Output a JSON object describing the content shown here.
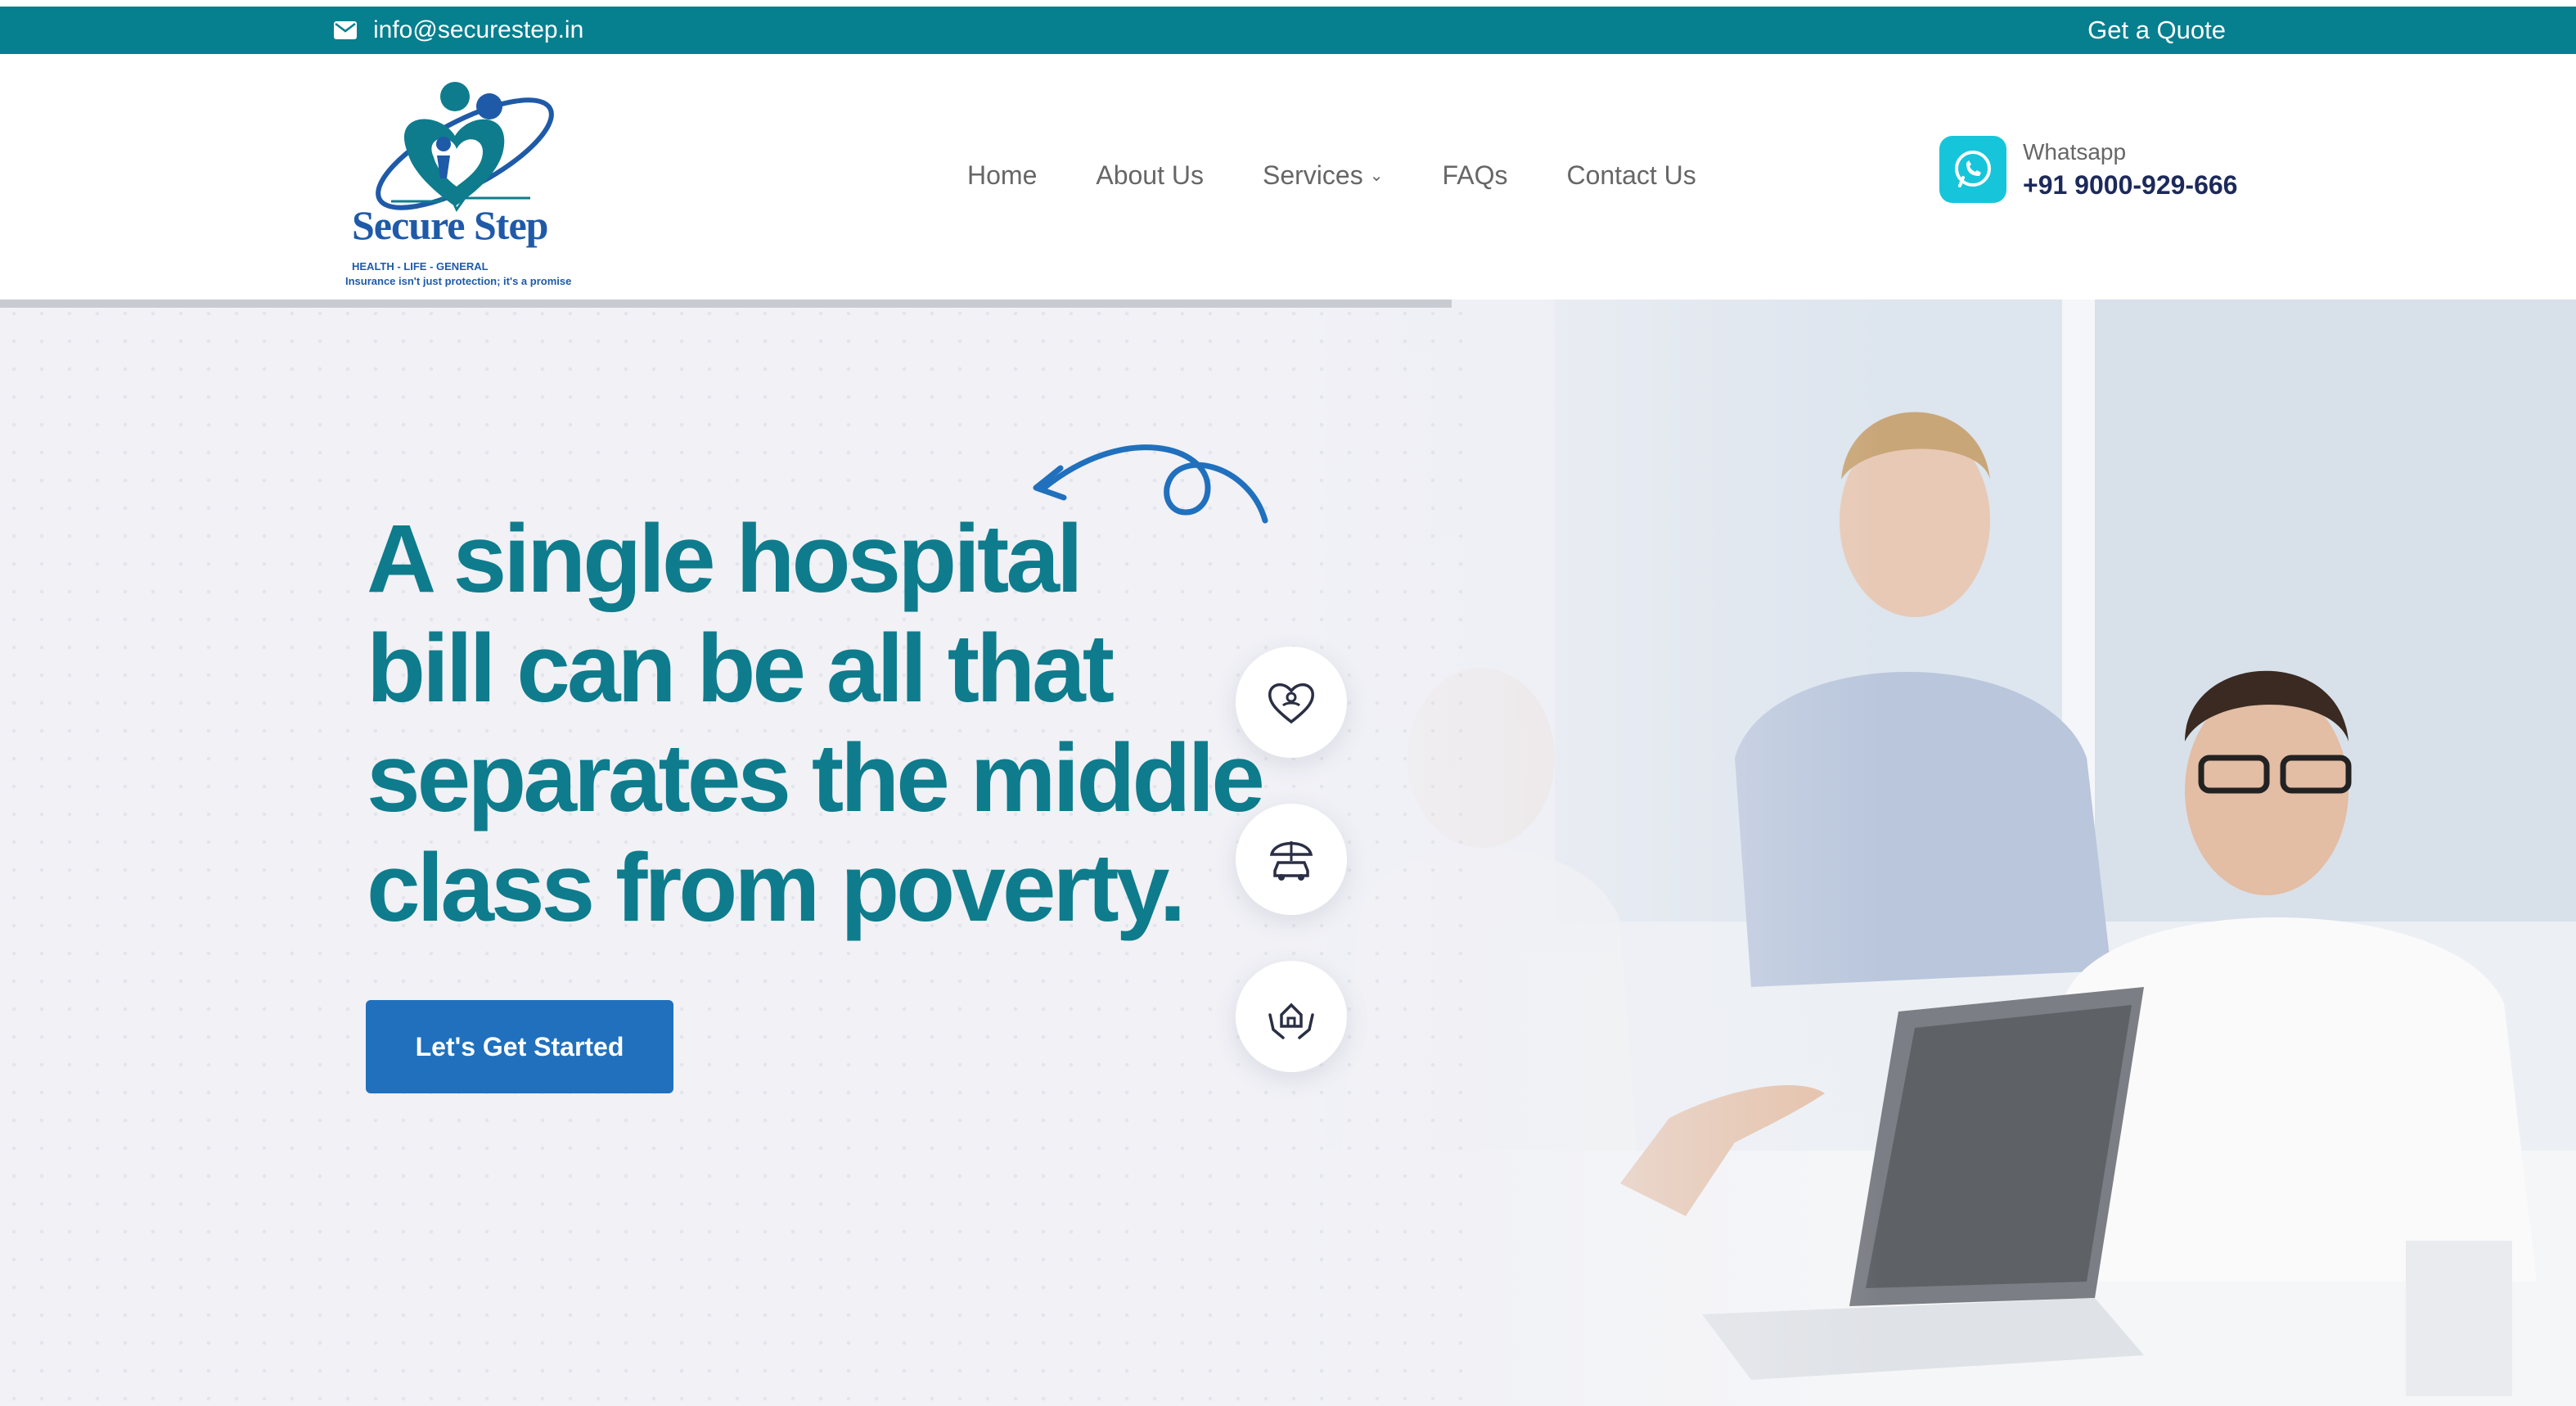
{
  "topbar": {
    "email": "info@securestep.in",
    "quote_label": "Get a Quote",
    "background": "#067f8f"
  },
  "header": {
    "logo": {
      "name": "Secure Step",
      "sub": "HEALTH - LIFE - GENERAL",
      "tagline": "Insurance isn't just protection; it's a promise"
    },
    "nav": [
      {
        "label": "Home"
      },
      {
        "label": "About Us"
      },
      {
        "label": "Services",
        "has_dropdown": true
      },
      {
        "label": "FAQs"
      },
      {
        "label": "Contact Us"
      }
    ],
    "whatsapp": {
      "label": "Whatsapp",
      "number": "+91 9000-929-666",
      "icon": "whatsapp-icon"
    }
  },
  "hero": {
    "headline_lines": [
      "A single hospital",
      "bill can be all that",
      "separates the middle",
      "class from poverty."
    ],
    "cta_label": "Let's Get Started",
    "side_icons": [
      "heart-care-icon",
      "car-umbrella-icon",
      "house-hands-icon"
    ],
    "colors": {
      "headline": "#0e7c8c",
      "cta": "#2070bd",
      "accent": "#17c5da"
    }
  }
}
